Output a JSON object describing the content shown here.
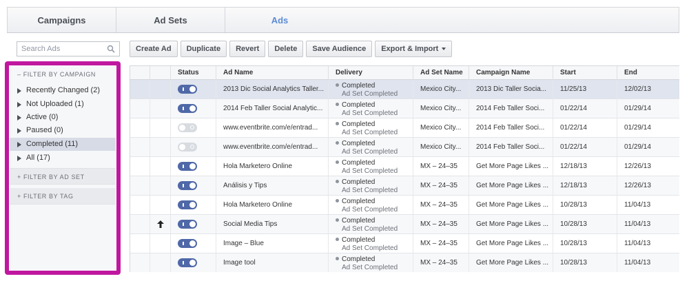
{
  "tabs": [
    {
      "label": "Campaigns"
    },
    {
      "label": "Ad Sets"
    },
    {
      "label": "Ads"
    }
  ],
  "search": {
    "placeholder": "Search Ads",
    "icon": "search-icon"
  },
  "filters": {
    "campaign_header": "– FILTER BY CAMPAIGN",
    "items": [
      {
        "label": "Recently Changed (2)"
      },
      {
        "label": "Not Uploaded (1)"
      },
      {
        "label": "Active (0)"
      },
      {
        "label": "Paused (0)"
      },
      {
        "label": "Completed (11)"
      },
      {
        "label": "All (17)"
      }
    ],
    "selected_item": "Completed (11)",
    "ad_set_header": "+ FILTER BY AD SET",
    "tag_header": "+ FILTER BY TAG"
  },
  "toolbar": {
    "create_ad": "Create Ad",
    "duplicate": "Duplicate",
    "revert": "Revert",
    "delete": "Delete",
    "save_audience": "Save Audience",
    "export_import": "Export & Import"
  },
  "table": {
    "headers": {
      "status": "Status",
      "ad_name": "Ad Name",
      "delivery": "Delivery",
      "ad_set_name": "Ad Set Name",
      "campaign_name": "Campaign Name",
      "start": "Start",
      "end": "End"
    },
    "rows": [
      {
        "on": true,
        "ad_name": "2013 Dic Social Analytics Taller...",
        "delivery": "Completed",
        "delivery_sub": "Ad Set Completed",
        "ad_set": "Mexico City...",
        "campaign": "2013 Dic Taller Socia...",
        "start": "11/25/13",
        "end": "12/02/13"
      },
      {
        "on": true,
        "ad_name": "2014 Feb Taller Social Analytic...",
        "delivery": "Completed",
        "delivery_sub": "Ad Set Completed",
        "ad_set": "Mexico City...",
        "campaign": "2014 Feb Taller Soci...",
        "start": "01/22/14",
        "end": "01/29/14"
      },
      {
        "on": false,
        "ad_name": "www.eventbrite.com/e/entrad...",
        "delivery": "Completed",
        "delivery_sub": "Ad Set Completed",
        "ad_set": "Mexico City...",
        "campaign": "2014 Feb Taller Soci...",
        "start": "01/22/14",
        "end": "01/29/14"
      },
      {
        "on": false,
        "ad_name": "www.eventbrite.com/e/entrad...",
        "delivery": "Completed",
        "delivery_sub": "Ad Set Completed",
        "ad_set": "Mexico City...",
        "campaign": "2014 Feb Taller Soci...",
        "start": "01/22/14",
        "end": "01/29/14"
      },
      {
        "on": true,
        "ad_name": "Hola Marketero Online",
        "delivery": "Completed",
        "delivery_sub": "Ad Set Completed",
        "ad_set": "MX – 24–35",
        "campaign": "Get More Page Likes ...",
        "start": "12/18/13",
        "end": "12/26/13"
      },
      {
        "on": true,
        "ad_name": "Análisis y Tips",
        "delivery": "Completed",
        "delivery_sub": "Ad Set Completed",
        "ad_set": "MX – 24–35",
        "campaign": "Get More Page Likes ...",
        "start": "12/18/13",
        "end": "12/26/13"
      },
      {
        "on": true,
        "ad_name": "Hola Marketero Online",
        "delivery": "Completed",
        "delivery_sub": "Ad Set Completed",
        "ad_set": "MX – 24–35",
        "campaign": "Get More Page Likes ...",
        "start": "10/28/13",
        "end": "11/04/13"
      },
      {
        "on": true,
        "ad_name": "Social Media Tips",
        "delivery": "Completed",
        "delivery_sub": "Ad Set Completed",
        "ad_set": "MX – 24–35",
        "campaign": "Get More Page Likes ...",
        "start": "10/28/13",
        "end": "11/04/13"
      },
      {
        "on": true,
        "ad_name": "Image – Blue",
        "delivery": "Completed",
        "delivery_sub": "Ad Set Completed",
        "ad_set": "MX – 24–35",
        "campaign": "Get More Page Likes ...",
        "start": "10/28/13",
        "end": "11/04/13"
      },
      {
        "on": true,
        "ad_name": "Image tool",
        "delivery": "Completed",
        "delivery_sub": "Ad Set Completed",
        "ad_set": "MX – 24–35",
        "campaign": "Get More Page Likes ...",
        "start": "10/28/13",
        "end": "11/04/13"
      }
    ]
  },
  "colors": {
    "active_tab": "#5b8bd6",
    "toggle_on": "#4f68a8",
    "highlight_border": "#c0179f"
  }
}
